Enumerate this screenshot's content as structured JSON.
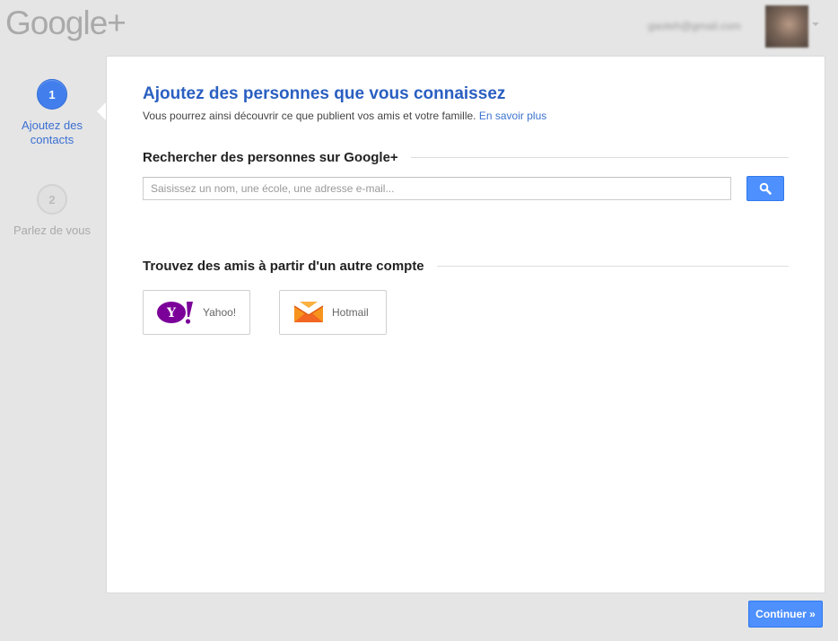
{
  "header": {
    "logo_text": "Google+",
    "account_email": "gaoteh@gmail.com"
  },
  "steps": [
    {
      "number": "1",
      "label": "Ajoutez des contacts",
      "active": true
    },
    {
      "number": "2",
      "label": "Parlez de vous",
      "active": false
    }
  ],
  "main": {
    "title": "Ajoutez des personnes que vous connaissez",
    "subtitle": "Vous pourrez ainsi découvrir ce que publient vos amis et votre famille.",
    "learn_more": "En savoir plus",
    "search_section_title": "Rechercher des personnes sur Google+",
    "search_placeholder": "Saisissez un nom, une école, une adresse e-mail...",
    "other_account_title": "Trouvez des amis à partir d'un autre compte",
    "accounts": [
      {
        "name": "Yahoo!",
        "icon": "yahoo-logo-icon",
        "color": "#7b0099"
      },
      {
        "name": "Hotmail",
        "icon": "hotmail-envelope-icon",
        "color": "#f26522"
      }
    ]
  },
  "footer": {
    "continue_label": "Continuer »"
  },
  "colors": {
    "accent": "#4d90fe",
    "title": "#2a5fc1",
    "link": "#3b73cf"
  }
}
